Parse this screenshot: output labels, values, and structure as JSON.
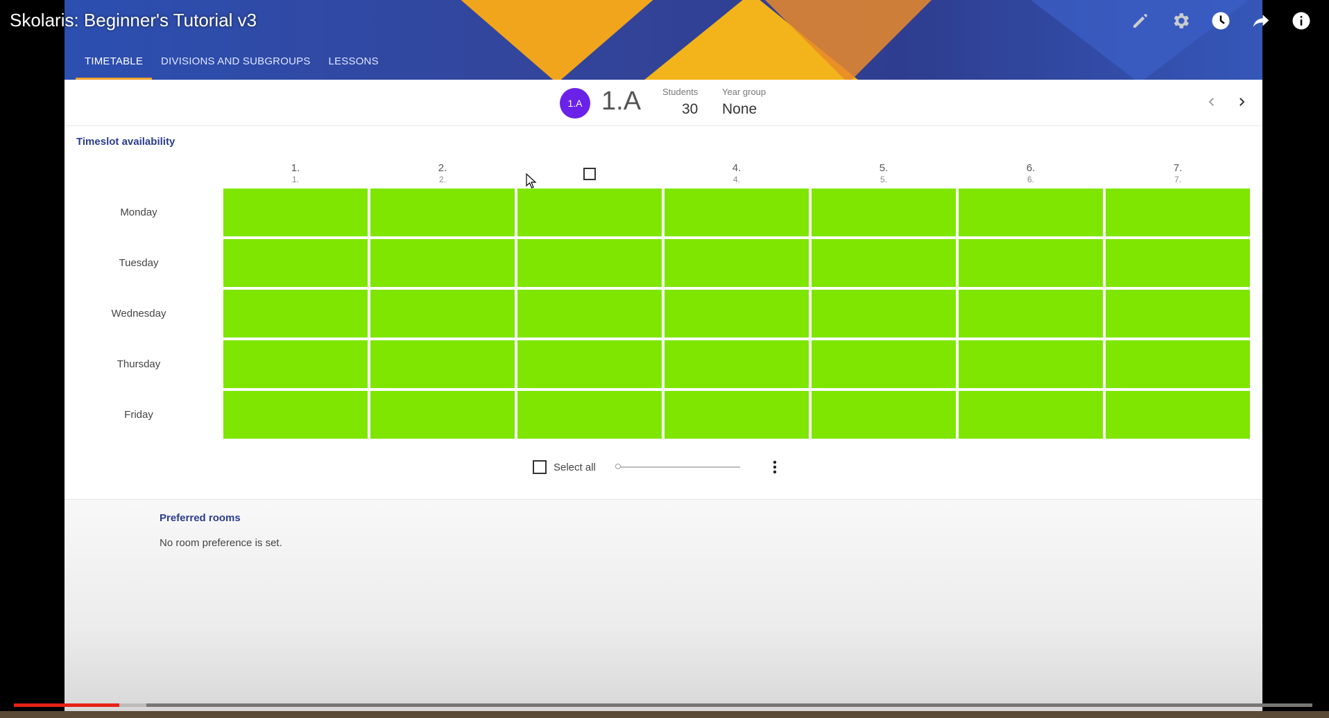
{
  "video": {
    "title": "Skolaris: Beginner's Tutorial v3",
    "progress": {
      "played_fraction": 0.081,
      "buffered_fraction": 0.102,
      "played_color": "#e62117"
    }
  },
  "overlay_icons": [
    "pencil-icon",
    "gear-icon",
    "clock-icon",
    "share-icon",
    "info-icon"
  ],
  "header": {
    "tabs": [
      {
        "label": "TIMETABLE",
        "active": true
      },
      {
        "label": "DIVISIONS AND SUBGROUPS",
        "active": false
      },
      {
        "label": "LESSONS",
        "active": false
      }
    ]
  },
  "class_info": {
    "avatar_text": "1.A",
    "avatar_color": "#6a22e8",
    "name": "1.A",
    "students_label": "Students",
    "students_value": "30",
    "year_group_label": "Year group",
    "year_group_value": "None"
  },
  "timeslot": {
    "title": "Timeslot availability",
    "available_color": "#7ee600",
    "periods": [
      {
        "line1": "1.",
        "line2": "1."
      },
      {
        "line1": "2.",
        "line2": "2."
      },
      {
        "line1": "",
        "line2": ""
      },
      {
        "line1": "4.",
        "line2": "4."
      },
      {
        "line1": "5.",
        "line2": "5."
      },
      {
        "line1": "6.",
        "line2": "6."
      },
      {
        "line1": "7.",
        "line2": "7."
      }
    ],
    "days": [
      "Monday",
      "Tuesday",
      "Wednesday",
      "Thursday",
      "Friday"
    ],
    "select_all_label": "Select all"
  },
  "preferred_rooms": {
    "title": "Preferred rooms",
    "text": "No room preference is set."
  }
}
